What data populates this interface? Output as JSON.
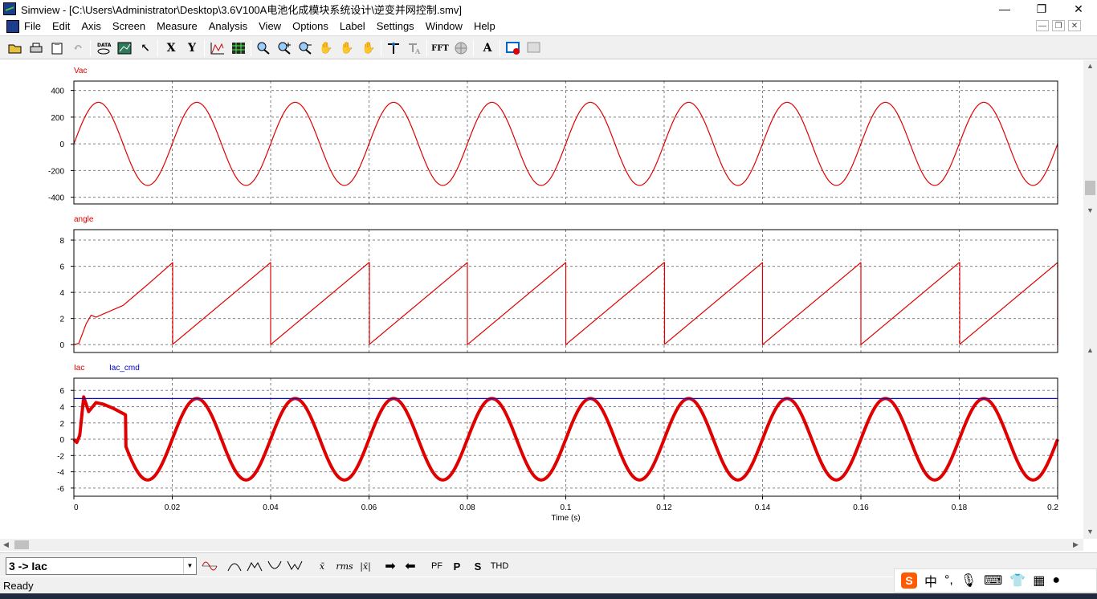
{
  "window": {
    "title": "Simview - [C:\\Users\\Administrator\\Desktop\\3.6V100A电池化成模块系统设计\\逆变并网控制.smv]",
    "minimize_glyph": "—",
    "maximize_glyph": "❐",
    "close_glyph": "✕"
  },
  "menu": [
    "File",
    "Edit",
    "Axis",
    "Screen",
    "Measure",
    "Analysis",
    "View",
    "Options",
    "Label",
    "Settings",
    "Window",
    "Help"
  ],
  "toolbar": {
    "x_label": "X",
    "y_label": "Y",
    "fft_label": "FFT",
    "text_label": "A"
  },
  "bottom_toolbar": {
    "selected_curve": "3 -> Iac",
    "avg_label": "x̄",
    "rms_label": "rms",
    "absavg_label": "|x̄|",
    "pf_label": "PF",
    "p_label": "P",
    "s_label": "S",
    "thd_label": "THD"
  },
  "status": "Ready",
  "colors": {
    "trace_red": "#e00000",
    "trace_blue": "#0000c8",
    "grid": "#808080"
  },
  "chart_data": [
    {
      "type": "line",
      "legend": [
        {
          "name": "Vac",
          "color": "#e00000"
        }
      ],
      "ylim": [
        -450,
        470
      ],
      "yticks": [
        400,
        200,
        0,
        -200,
        -400
      ],
      "xlim": [
        0,
        0.2
      ],
      "series": [
        {
          "name": "Vac",
          "kind": "sine",
          "amplitude": 311,
          "frequency_hz": 50,
          "phase": 0
        }
      ]
    },
    {
      "type": "line",
      "legend": [
        {
          "name": "angle",
          "color": "#e00000"
        }
      ],
      "ylim": [
        -0.6,
        8.8
      ],
      "yticks": [
        8,
        6,
        4,
        2,
        0
      ],
      "xlim": [
        0,
        0.2
      ],
      "series": [
        {
          "name": "angle",
          "kind": "sawtooth",
          "peak": 6.283,
          "period_s": 0.02,
          "startup": [
            [
              0,
              0
            ],
            [
              0.001,
              0.1
            ],
            [
              0.0025,
              1.6
            ],
            [
              0.0035,
              2.25
            ],
            [
              0.0045,
              2.1
            ],
            [
              0.006,
              2.35
            ],
            [
              0.01,
              3.0
            ],
            [
              0.015,
              4.6
            ],
            [
              0.02,
              6.25
            ]
          ]
        }
      ]
    },
    {
      "type": "line",
      "legend": [
        {
          "name": "Iac",
          "color": "#e00000"
        },
        {
          "name": "Iac_cmd",
          "color": "#0000c8"
        }
      ],
      "ylim": [
        -7,
        7.5
      ],
      "yticks": [
        6,
        4,
        2,
        0,
        -2,
        -4,
        -6
      ],
      "xlim": [
        0,
        0.2
      ],
      "xticks": [
        "0",
        "0.02",
        "0.04",
        "0.06",
        "0.08",
        "0.1",
        "0.12",
        "0.14",
        "0.16",
        "0.18",
        "0.2"
      ],
      "xlabel": "Time (s)",
      "series": [
        {
          "name": "Iac",
          "kind": "sine",
          "amplitude": 5,
          "frequency_hz": 50,
          "phase": 0,
          "startup": [
            [
              0,
              0
            ],
            [
              0.0006,
              -0.4
            ],
            [
              0.0012,
              0.5
            ],
            [
              0.002,
              5.2
            ],
            [
              0.003,
              3.4
            ],
            [
              0.0045,
              4.5
            ],
            [
              0.006,
              4.3
            ],
            [
              0.008,
              3.8
            ],
            [
              0.0105,
              3.0
            ]
          ]
        },
        {
          "name": "Iac_cmd",
          "kind": "constant",
          "value": 5
        }
      ]
    }
  ]
}
